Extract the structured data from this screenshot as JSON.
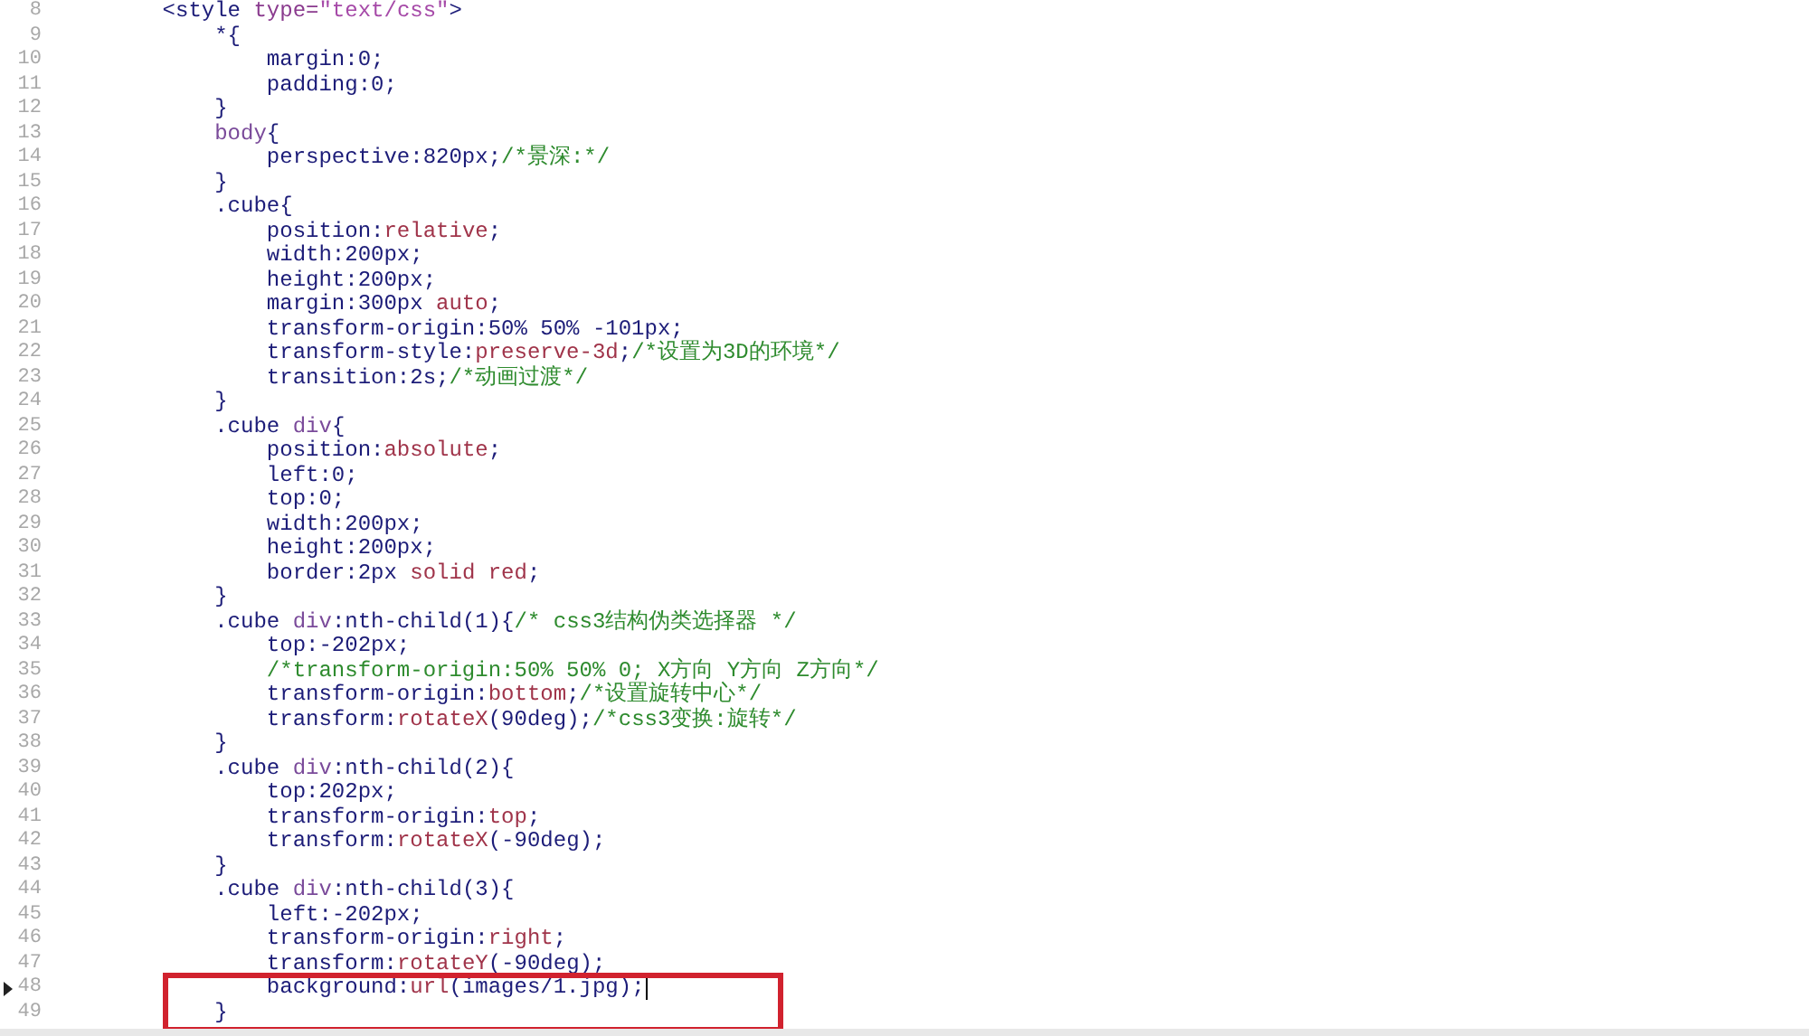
{
  "editor": {
    "lines": [
      {
        "number": "8",
        "current": false,
        "tokens": [
          {
            "kind": "tag",
            "text": "    <style "
          },
          {
            "kind": "attr",
            "text": "type="
          },
          {
            "kind": "string",
            "text": "\"text/css\""
          },
          {
            "kind": "tag",
            "text": ">"
          }
        ]
      },
      {
        "number": "9",
        "current": false,
        "tokens": [
          {
            "kind": "plain",
            "text": "        *{"
          }
        ]
      },
      {
        "number": "10",
        "current": false,
        "tokens": [
          {
            "kind": "plain",
            "text": "            margin:0;"
          }
        ]
      },
      {
        "number": "11",
        "current": false,
        "tokens": [
          {
            "kind": "plain",
            "text": "            padding:0;"
          }
        ]
      },
      {
        "number": "12",
        "current": false,
        "tokens": [
          {
            "kind": "plain",
            "text": "        }"
          }
        ]
      },
      {
        "number": "13",
        "current": false,
        "tokens": [
          {
            "kind": "element",
            "text": "        body"
          },
          {
            "kind": "plain",
            "text": "{"
          }
        ]
      },
      {
        "number": "14",
        "current": false,
        "tokens": [
          {
            "kind": "plain",
            "text": "            perspective:820px;"
          },
          {
            "kind": "comment",
            "text": "/*景深:*/"
          }
        ]
      },
      {
        "number": "15",
        "current": false,
        "tokens": [
          {
            "kind": "plain",
            "text": "        }"
          }
        ]
      },
      {
        "number": "16",
        "current": false,
        "tokens": [
          {
            "kind": "plain",
            "text": "        .cube{"
          }
        ]
      },
      {
        "number": "17",
        "current": false,
        "tokens": [
          {
            "kind": "plain",
            "text": "            position:"
          },
          {
            "kind": "value",
            "text": "relative"
          },
          {
            "kind": "plain",
            "text": ";"
          }
        ]
      },
      {
        "number": "18",
        "current": false,
        "tokens": [
          {
            "kind": "plain",
            "text": "            width:200px;"
          }
        ]
      },
      {
        "number": "19",
        "current": false,
        "tokens": [
          {
            "kind": "plain",
            "text": "            height:200px;"
          }
        ]
      },
      {
        "number": "20",
        "current": false,
        "tokens": [
          {
            "kind": "plain",
            "text": "            margin:300px "
          },
          {
            "kind": "value",
            "text": "auto"
          },
          {
            "kind": "plain",
            "text": ";"
          }
        ]
      },
      {
        "number": "21",
        "current": false,
        "tokens": [
          {
            "kind": "plain",
            "text": "            transform-origin:50% 50% -101px;"
          }
        ]
      },
      {
        "number": "22",
        "current": false,
        "tokens": [
          {
            "kind": "plain",
            "text": "            transform-style:"
          },
          {
            "kind": "value",
            "text": "preserve-3d"
          },
          {
            "kind": "plain",
            "text": ";"
          },
          {
            "kind": "comment",
            "text": "/*设置为3D的环境*/"
          }
        ]
      },
      {
        "number": "23",
        "current": false,
        "tokens": [
          {
            "kind": "plain",
            "text": "            transition:2s;"
          },
          {
            "kind": "comment",
            "text": "/*动画过渡*/"
          }
        ]
      },
      {
        "number": "24",
        "current": false,
        "tokens": [
          {
            "kind": "plain",
            "text": "        }"
          }
        ]
      },
      {
        "number": "25",
        "current": false,
        "tokens": [
          {
            "kind": "plain",
            "text": "        .cube "
          },
          {
            "kind": "element",
            "text": "div"
          },
          {
            "kind": "plain",
            "text": "{"
          }
        ]
      },
      {
        "number": "26",
        "current": false,
        "tokens": [
          {
            "kind": "plain",
            "text": "            position:"
          },
          {
            "kind": "value",
            "text": "absolute"
          },
          {
            "kind": "plain",
            "text": ";"
          }
        ]
      },
      {
        "number": "27",
        "current": false,
        "tokens": [
          {
            "kind": "plain",
            "text": "            left:0;"
          }
        ]
      },
      {
        "number": "28",
        "current": false,
        "tokens": [
          {
            "kind": "plain",
            "text": "            top:0;"
          }
        ]
      },
      {
        "number": "29",
        "current": false,
        "tokens": [
          {
            "kind": "plain",
            "text": "            width:200px;"
          }
        ]
      },
      {
        "number": "30",
        "current": false,
        "tokens": [
          {
            "kind": "plain",
            "text": "            height:200px;"
          }
        ]
      },
      {
        "number": "31",
        "current": false,
        "tokens": [
          {
            "kind": "plain",
            "text": "            border:2px "
          },
          {
            "kind": "value",
            "text": "solid red"
          },
          {
            "kind": "plain",
            "text": ";"
          }
        ]
      },
      {
        "number": "32",
        "current": false,
        "tokens": [
          {
            "kind": "plain",
            "text": "        }"
          }
        ]
      },
      {
        "number": "33",
        "current": false,
        "tokens": [
          {
            "kind": "plain",
            "text": "        .cube "
          },
          {
            "kind": "element",
            "text": "div"
          },
          {
            "kind": "plain",
            "text": ":nth-child(1){"
          },
          {
            "kind": "comment",
            "text": "/* css3结构伪类选择器 */"
          }
        ]
      },
      {
        "number": "34",
        "current": false,
        "tokens": [
          {
            "kind": "plain",
            "text": "            top:-202px;"
          }
        ]
      },
      {
        "number": "35",
        "current": false,
        "tokens": [
          {
            "kind": "comment",
            "text": "            /*transform-origin:50% 50% 0; X方向 Y方向 Z方向*/"
          }
        ]
      },
      {
        "number": "36",
        "current": false,
        "tokens": [
          {
            "kind": "plain",
            "text": "            transform-origin:"
          },
          {
            "kind": "value",
            "text": "bottom"
          },
          {
            "kind": "plain",
            "text": ";"
          },
          {
            "kind": "comment",
            "text": "/*设置旋转中心*/"
          }
        ]
      },
      {
        "number": "37",
        "current": false,
        "tokens": [
          {
            "kind": "plain",
            "text": "            transform:"
          },
          {
            "kind": "value",
            "text": "rotateX"
          },
          {
            "kind": "plain",
            "text": "(90deg);"
          },
          {
            "kind": "comment",
            "text": "/*css3变换:旋转*/"
          }
        ]
      },
      {
        "number": "38",
        "current": false,
        "tokens": [
          {
            "kind": "plain",
            "text": "        }"
          }
        ]
      },
      {
        "number": "39",
        "current": false,
        "tokens": [
          {
            "kind": "plain",
            "text": "        .cube "
          },
          {
            "kind": "element",
            "text": "div"
          },
          {
            "kind": "plain",
            "text": ":nth-child(2){"
          }
        ]
      },
      {
        "number": "40",
        "current": false,
        "tokens": [
          {
            "kind": "plain",
            "text": "            top:202px;"
          }
        ]
      },
      {
        "number": "41",
        "current": false,
        "tokens": [
          {
            "kind": "plain",
            "text": "            transform-origin:"
          },
          {
            "kind": "value",
            "text": "top"
          },
          {
            "kind": "plain",
            "text": ";"
          }
        ]
      },
      {
        "number": "42",
        "current": false,
        "tokens": [
          {
            "kind": "plain",
            "text": "            transform:"
          },
          {
            "kind": "value",
            "text": "rotateX"
          },
          {
            "kind": "plain",
            "text": "(-90deg);"
          }
        ]
      },
      {
        "number": "43",
        "current": false,
        "tokens": [
          {
            "kind": "plain",
            "text": "        }"
          }
        ]
      },
      {
        "number": "44",
        "current": false,
        "tokens": [
          {
            "kind": "plain",
            "text": "        .cube "
          },
          {
            "kind": "element",
            "text": "div"
          },
          {
            "kind": "plain",
            "text": ":nth-child(3){"
          }
        ]
      },
      {
        "number": "45",
        "current": false,
        "tokens": [
          {
            "kind": "plain",
            "text": "            left:-202px;"
          }
        ]
      },
      {
        "number": "46",
        "current": false,
        "tokens": [
          {
            "kind": "plain",
            "text": "            transform-origin:"
          },
          {
            "kind": "value",
            "text": "right"
          },
          {
            "kind": "plain",
            "text": ";"
          }
        ]
      },
      {
        "number": "47",
        "current": false,
        "tokens": [
          {
            "kind": "plain",
            "text": "            transform:"
          },
          {
            "kind": "value",
            "text": "rotateY"
          },
          {
            "kind": "plain",
            "text": "(-90deg);"
          }
        ]
      },
      {
        "number": "48",
        "current": true,
        "tokens": [
          {
            "kind": "plain",
            "text": "            background:"
          },
          {
            "kind": "value",
            "text": "url"
          },
          {
            "kind": "plain",
            "text": "(images/1.jpg);"
          }
        ]
      },
      {
        "number": "49",
        "current": false,
        "tokens": [
          {
            "kind": "plain",
            "text": "        }"
          }
        ]
      }
    ]
  }
}
